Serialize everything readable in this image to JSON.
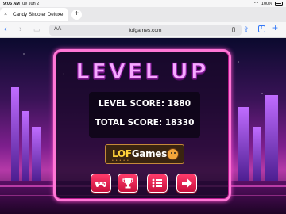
{
  "status_bar": {
    "time": "9:05 AM",
    "date": "Tue Jun 2",
    "battery": "100%"
  },
  "tabs": [
    {
      "label": "Candy Shooter Deluxe"
    }
  ],
  "toolbar": {
    "url": "lofgames.com",
    "reader_label": "AA",
    "tab_count": "1"
  },
  "icons": [
    "close-icon",
    "new-tab-icon",
    "back-arrow-icon",
    "forward-arrow-icon",
    "sidebar-icon",
    "microphone-icon",
    "share-icon",
    "tabs-icon",
    "new-tab-plus-icon",
    "gamepad-icon",
    "trophy-icon",
    "list-icon",
    "arrow-right-icon"
  ],
  "game": {
    "title": "LEVEL UP",
    "level_score_label": "LEVEL SCORE: 1880",
    "total_score_label": "TOTAL SCORE: 18330",
    "logo": {
      "part1": "LOF",
      "part2": "Games"
    }
  },
  "colors": {
    "accent": "#3478f6",
    "panel_border": "#ff77d6",
    "button": "#e8204f",
    "title": "#f6a8ff"
  }
}
